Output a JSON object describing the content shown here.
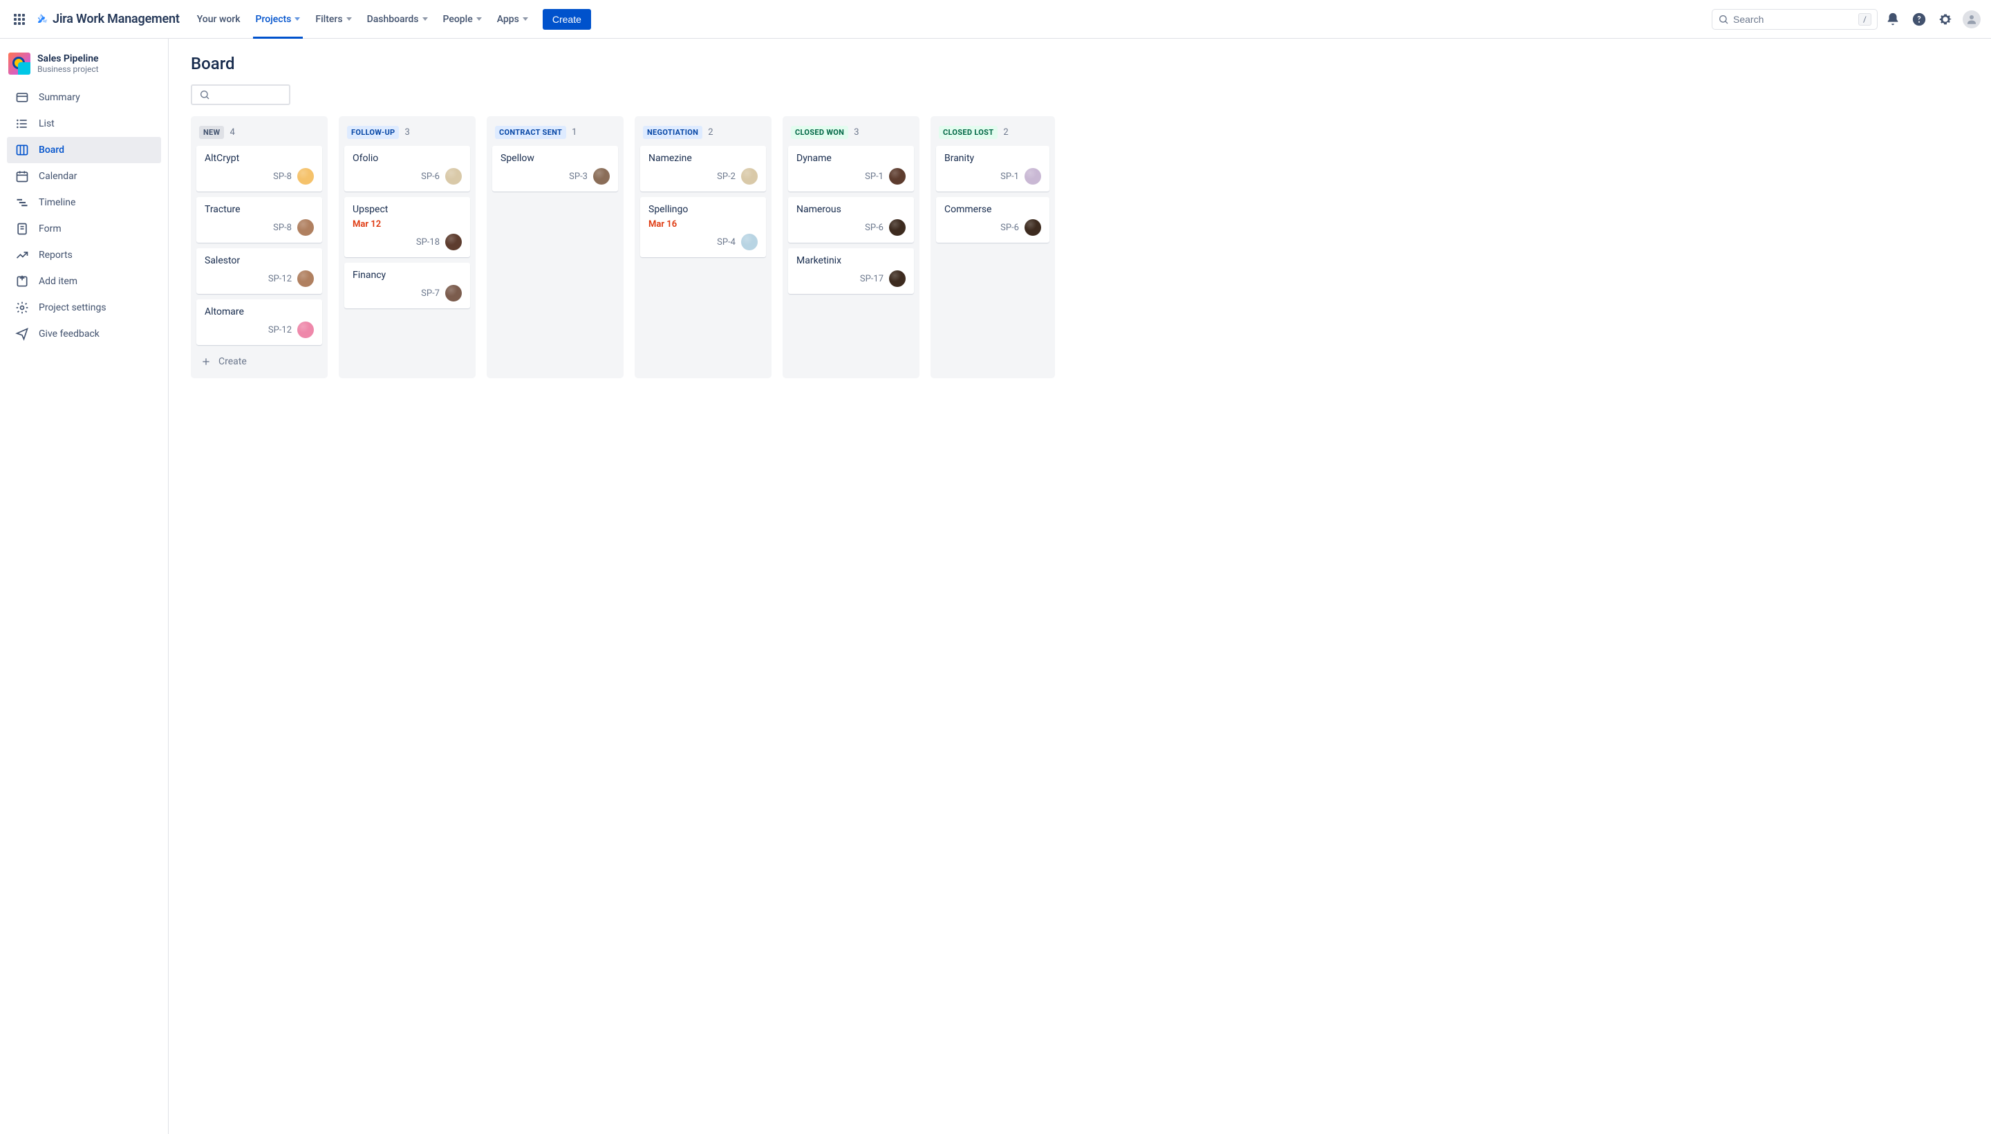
{
  "topnav": {
    "product": "Jira Work Management",
    "items": [
      {
        "label": "Your work",
        "dropdown": false,
        "active": false
      },
      {
        "label": "Projects",
        "dropdown": true,
        "active": true
      },
      {
        "label": "Filters",
        "dropdown": true,
        "active": false
      },
      {
        "label": "Dashboards",
        "dropdown": true,
        "active": false
      },
      {
        "label": "People",
        "dropdown": true,
        "active": false
      },
      {
        "label": "Apps",
        "dropdown": true,
        "active": false
      }
    ],
    "create": "Create",
    "search_placeholder": "Search",
    "search_shortcut": "/"
  },
  "project": {
    "name": "Sales Pipeline",
    "type": "Business project"
  },
  "sidebar": [
    {
      "label": "Summary",
      "icon": "card",
      "active": false
    },
    {
      "label": "List",
      "icon": "list",
      "active": false
    },
    {
      "label": "Board",
      "icon": "board",
      "active": true
    },
    {
      "label": "Calendar",
      "icon": "calendar",
      "active": false
    },
    {
      "label": "Timeline",
      "icon": "timeline",
      "active": false
    },
    {
      "label": "Form",
      "icon": "form",
      "active": false
    },
    {
      "label": "Reports",
      "icon": "reports",
      "active": false
    },
    {
      "label": "Add item",
      "icon": "add",
      "active": false
    },
    {
      "label": "Project settings",
      "icon": "settings",
      "active": false
    },
    {
      "label": "Give feedback",
      "icon": "feedback",
      "active": false
    }
  ],
  "page": {
    "title": "Board"
  },
  "board": {
    "create_label": "Create",
    "columns": [
      {
        "title": "NEW",
        "count": 4,
        "style": "gray",
        "cards": [
          {
            "title": "AltCrypt",
            "key": "SP-8",
            "avatar": "#f5c26b"
          },
          {
            "title": "Tracture",
            "key": "SP-8",
            "avatar": "#b08060"
          },
          {
            "title": "Salestor",
            "key": "SP-12",
            "avatar": "#b08060"
          },
          {
            "title": "Altomare",
            "key": "SP-12",
            "avatar": "#e8a"
          }
        ],
        "show_create": true
      },
      {
        "title": "FOLLOW-UP",
        "count": 3,
        "style": "blue",
        "cards": [
          {
            "title": "Ofolio",
            "key": "SP-6",
            "avatar": "#d9c9a8"
          },
          {
            "title": "Upspect",
            "date": "Mar 12",
            "key": "SP-18",
            "avatar": "#5d3c2e"
          },
          {
            "title": "Financy",
            "key": "SP-7",
            "avatar": "#7b5c4d"
          }
        ]
      },
      {
        "title": "CONTRACT SENT",
        "count": 1,
        "style": "blue",
        "cards": [
          {
            "title": "Spellow",
            "key": "SP-3",
            "avatar": "#8a6d58"
          }
        ]
      },
      {
        "title": "NEGOTIATION",
        "count": 2,
        "style": "blue",
        "cards": [
          {
            "title": "Namezine",
            "key": "SP-2",
            "avatar": "#d9c9a8"
          },
          {
            "title": "Spellingo",
            "date": "Mar 16",
            "key": "SP-4",
            "avatar": "#b8d4e3"
          }
        ]
      },
      {
        "title": "CLOSED WON",
        "count": 3,
        "style": "green",
        "cards": [
          {
            "title": "Dyname",
            "key": "SP-1",
            "avatar": "#5d3c2e"
          },
          {
            "title": "Namerous",
            "key": "SP-6",
            "avatar": "#3d2b1f"
          },
          {
            "title": "Marketinix",
            "key": "SP-17",
            "avatar": "#3d2b1f"
          }
        ]
      },
      {
        "title": "CLOSED LOST",
        "count": 2,
        "style": "green",
        "cards": [
          {
            "title": "Branity",
            "key": "SP-1",
            "avatar": "#c9b8d4"
          },
          {
            "title": "Commerse",
            "key": "SP-6",
            "avatar": "#3d2b1f"
          }
        ]
      }
    ]
  }
}
